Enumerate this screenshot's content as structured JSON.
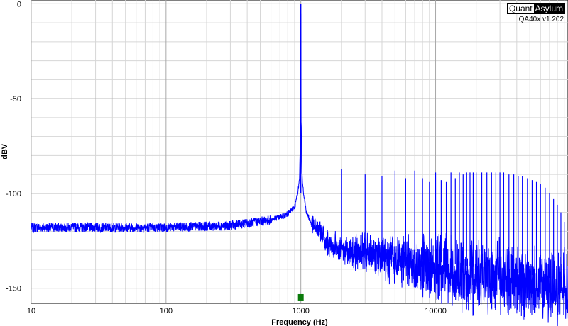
{
  "brand": {
    "name_part1": "Quant",
    "name_part2": "Asylum",
    "version": "QA40x v1.202"
  },
  "chart_data": {
    "type": "line",
    "title": "",
    "xlabel": "Frequency (Hz)",
    "ylabel": "dBV",
    "xscale": "log",
    "xlim": [
      10,
      96000
    ],
    "ylim": [
      -158,
      2
    ],
    "grid": true,
    "x_ticks": [
      10,
      100,
      1000,
      10000
    ],
    "x_tick_labels": [
      "10",
      "100",
      "1000",
      "10000"
    ],
    "y_ticks": [
      0,
      -50,
      -100,
      -150
    ],
    "y_tick_labels": [
      "0",
      "-50",
      "-100",
      "-150"
    ],
    "series": [
      {
        "color": "#0000ff",
        "noise_floor": [
          [
            10,
            -118
          ],
          [
            30,
            -118
          ],
          [
            100,
            -118
          ],
          [
            300,
            -117
          ],
          [
            600,
            -114
          ],
          [
            800,
            -111
          ],
          [
            900,
            -107
          ],
          [
            950,
            -100
          ],
          [
            980,
            -90
          ],
          [
            995,
            -60
          ],
          [
            1000,
            0
          ],
          [
            1005,
            -60
          ],
          [
            1020,
            -90
          ],
          [
            1050,
            -100
          ],
          [
            1100,
            -110
          ],
          [
            1200,
            -116
          ],
          [
            1500,
            -122
          ],
          [
            2000,
            -125
          ],
          [
            3000,
            -127
          ],
          [
            5000,
            -129
          ],
          [
            10000,
            -132
          ],
          [
            20000,
            -135
          ],
          [
            40000,
            -138
          ],
          [
            96000,
            -142
          ]
        ],
        "harmonics": [
          [
            2000,
            -87
          ],
          [
            3000,
            -90
          ],
          [
            4000,
            -91
          ],
          [
            5000,
            -88
          ],
          [
            6000,
            -92
          ],
          [
            7000,
            -88
          ],
          [
            8000,
            -92
          ],
          [
            9000,
            -94
          ],
          [
            10000,
            -89
          ],
          [
            11000,
            -93
          ],
          [
            12000,
            -94
          ],
          [
            13000,
            -89
          ],
          [
            14000,
            -92
          ],
          [
            15000,
            -89
          ],
          [
            16000,
            -90
          ],
          [
            17000,
            -89
          ],
          [
            18000,
            -89
          ],
          [
            19000,
            -89
          ],
          [
            20000,
            -89
          ],
          [
            22000,
            -89
          ],
          [
            24000,
            -89
          ],
          [
            26000,
            -89
          ],
          [
            28000,
            -89
          ],
          [
            30000,
            -89
          ],
          [
            32000,
            -89
          ],
          [
            35000,
            -90
          ],
          [
            38000,
            -90
          ],
          [
            41000,
            -91
          ],
          [
            44000,
            -91
          ],
          [
            48000,
            -92
          ],
          [
            52000,
            -93
          ],
          [
            56000,
            -94
          ],
          [
            60000,
            -95
          ],
          [
            65000,
            -97
          ],
          [
            70000,
            -100
          ],
          [
            75000,
            -103
          ],
          [
            80000,
            -106
          ],
          [
            85000,
            -110
          ],
          [
            90000,
            -115
          ]
        ]
      }
    ],
    "marker": {
      "x": 1000,
      "y": -155,
      "color": "#0a7a0a"
    }
  }
}
